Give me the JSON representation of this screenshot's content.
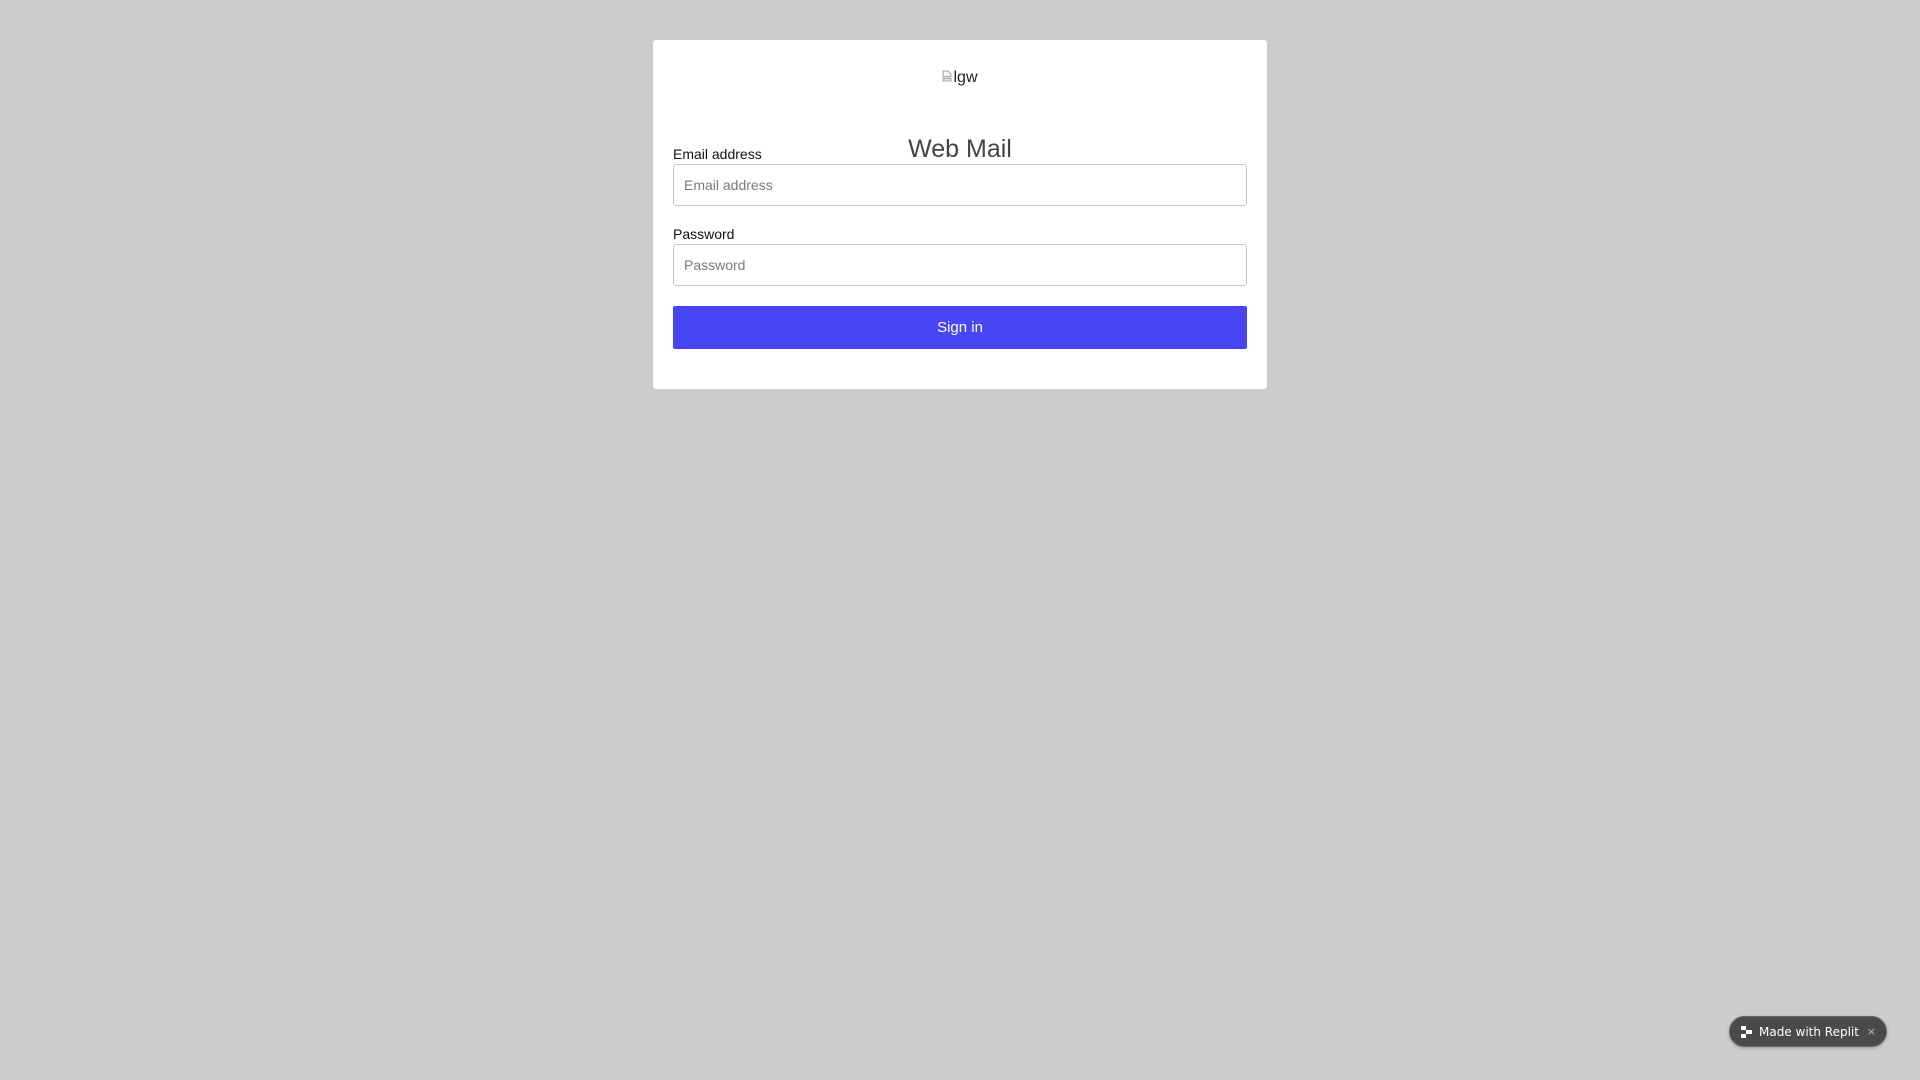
{
  "logo": {
    "alt_text": "lgw"
  },
  "title": "Web Mail",
  "form": {
    "email_label": "Email address",
    "email_placeholder": "Email address",
    "email_value": "",
    "password_label": "Password",
    "password_placeholder": "Password",
    "password_value": "",
    "submit_label": "Sign in"
  },
  "badge": {
    "text": "Made with Replit",
    "close_glyph": "×",
    "icon": "replit-logo-icon"
  },
  "colors": {
    "background": "#cccccc",
    "card": "#ffffff",
    "primary_button": "#4845f5",
    "badge": "#4a4a4a"
  }
}
